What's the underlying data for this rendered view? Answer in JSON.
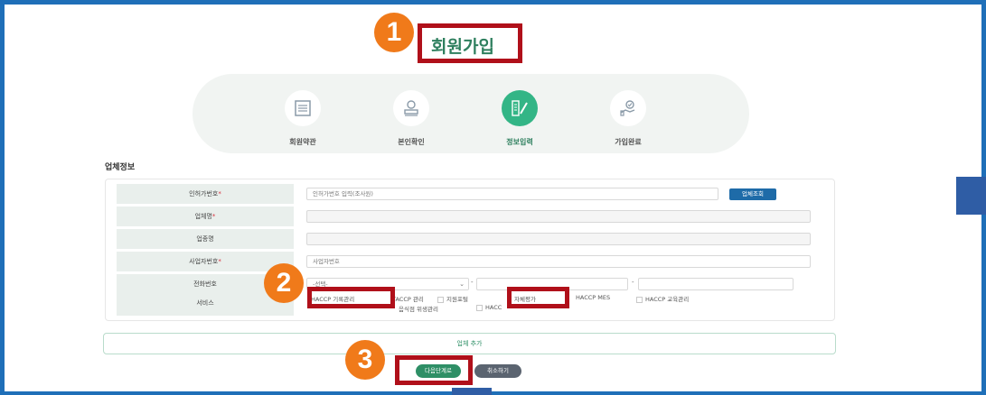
{
  "page": {
    "title": "회원가입"
  },
  "steps": [
    {
      "label": "회원약관",
      "icon": "document-list-icon"
    },
    {
      "label": "본인확인",
      "icon": "person-card-icon"
    },
    {
      "label": "정보입력",
      "icon": "edit-pencil-icon",
      "active": true
    },
    {
      "label": "가입완료",
      "icon": "handshake-check-icon"
    }
  ],
  "section": {
    "title": "업체정보"
  },
  "form": {
    "company_code": {
      "label": "인허가번호",
      "value": "인허가번호 입력(조사원)",
      "button": "업체조회"
    },
    "company_name": {
      "label": "업체명"
    },
    "industry": {
      "label": "업종명"
    },
    "business_no": {
      "label": "사업자번호",
      "placeholder": "사업자번호"
    },
    "phone": {
      "label": "전화번호",
      "select": "-선택-",
      "sep1": "-",
      "sep2": "-"
    },
    "service": {
      "label": "서비스",
      "options": [
        "HACCP 기록관리",
        "TACCP 관리",
        "지원포털",
        "자체평가",
        "HACCP MES",
        "HACCP 교육관리",
        "음식점 위생관리",
        "HACC"
      ]
    }
  },
  "add_company": "업체 추가",
  "buttons": {
    "next": "다음단계로",
    "cancel": "취소하기"
  },
  "markers": [
    "1",
    "2",
    "3"
  ],
  "colors": {
    "primary": "#2e8f66",
    "highlight": "#b0101a",
    "marker": "#f07a1a",
    "frame": "#1f6fb8"
  }
}
